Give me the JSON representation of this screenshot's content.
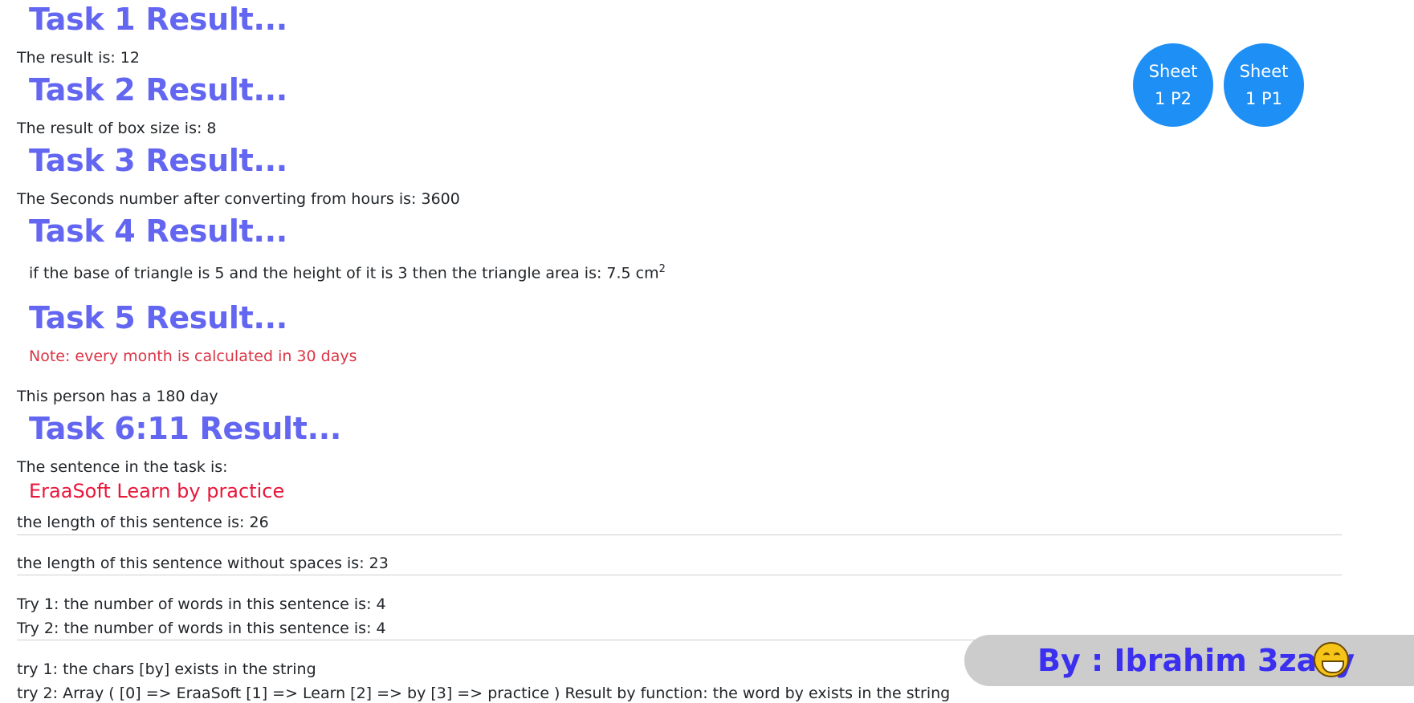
{
  "tasks": {
    "t1": {
      "heading": "Task 1 Result...",
      "result": "The result is: 12"
    },
    "t2": {
      "heading": "Task 2 Result...",
      "result": "The result of box size is: 8"
    },
    "t3": {
      "heading": "Task 3 Result...",
      "result": "The Seconds number after converting from hours is: 3600"
    },
    "t4": {
      "heading": "Task 4 Result...",
      "result": "if the base of triangle is 5 and the height of it is 3 then the triangle area is: 7.5 cm",
      "superscript": "2"
    },
    "t5": {
      "heading": "Task 5 Result...",
      "note": "Note: every month is calculated in 30 days",
      "result": "This person has a 180 day"
    },
    "t6": {
      "heading": "Task 6:11 Result...",
      "intro": "The sentence in the task is:",
      "sentence": "EraaSoft Learn by practice",
      "length": "the length of this sentence is: 26",
      "length_no_spaces": "the length of this sentence without spaces is: 23",
      "words_try1": "Try 1: the number of words in this sentence is: 4",
      "words_try2": "Try 2: the number of words in this sentence is: 4",
      "chars_try1": "try 1: the chars [by] exists in the string",
      "chars_try2": "try 2: Array ( [0] => EraaSoft [1] => Learn [2] => by [3] => practice ) Result by function: the word by exists in the string"
    }
  },
  "nav": {
    "sheet_p2": {
      "line1": "Sheet",
      "line2": "1 P2"
    },
    "sheet_p1": {
      "line1": "Sheet",
      "line2": "1 P1"
    }
  },
  "footer": {
    "text": "By : Ibrahim 3zazy",
    "emoji": "grinning-face-icon"
  },
  "colors": {
    "heading": "#6366f1",
    "note": "#dc3545",
    "sentence": "#e8173a",
    "button": "#1e8ff5",
    "footer_text": "#3b2ff0",
    "footer_bg": "#cccccc"
  }
}
